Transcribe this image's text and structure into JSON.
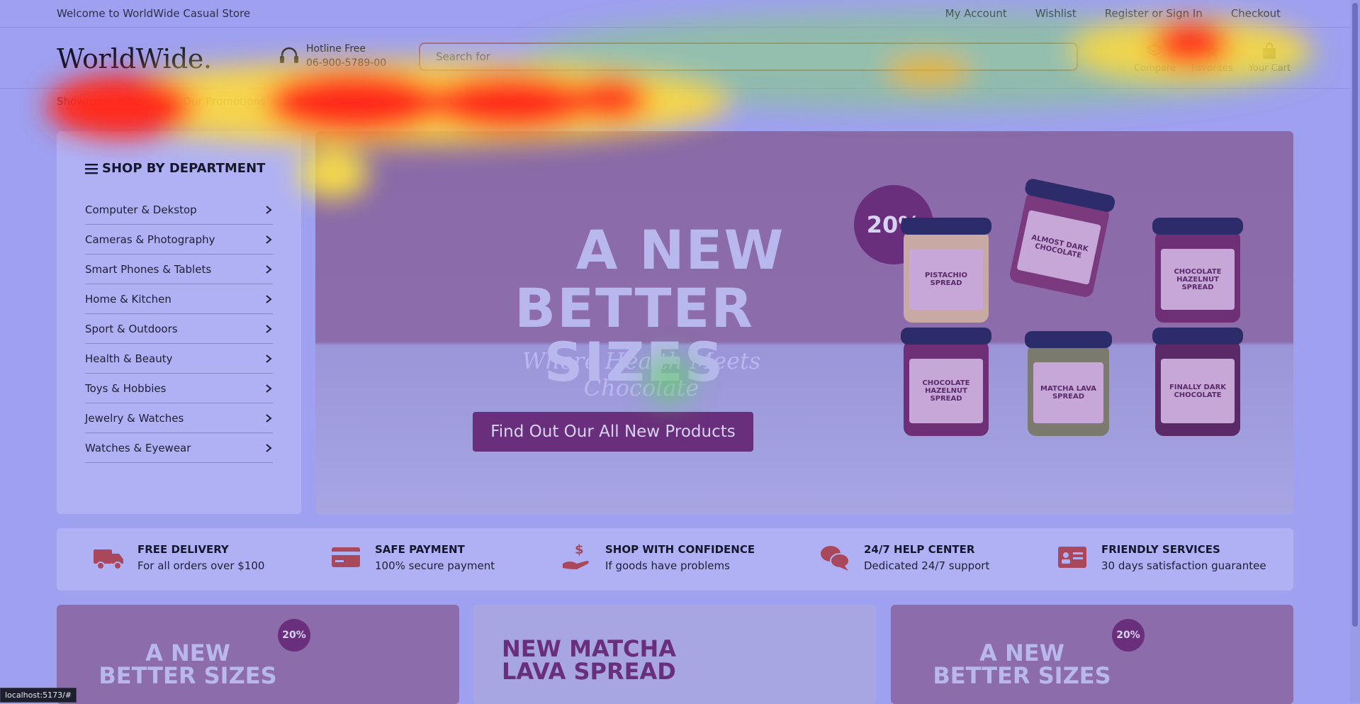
{
  "topbar": {
    "welcome": "Welcome to WorldWide Casual Store",
    "links": [
      "My Account",
      "Wishlist",
      "Register or Sign In",
      "Checkout"
    ]
  },
  "header": {
    "logo": "WorldWide.",
    "hotline_label": "Hotline Free",
    "hotline_number": "06-900-5789-00",
    "search_placeholder": "Search for",
    "icons": [
      {
        "label": "Compare",
        "icon": "compare-icon"
      },
      {
        "label": "Favorites",
        "icon": "star-icon"
      },
      {
        "label": "Your Cart",
        "icon": "cart-icon"
      }
    ]
  },
  "nav": [
    "Showroom system",
    "Our Promotions",
    "Track your order",
    "Services",
    "Support Customer"
  ],
  "sidebar": {
    "title": "SHOP BY DEPARTMENT",
    "categories": [
      "Computer & Dekstop",
      "Cameras & Photography",
      "Smart Phones & Tablets",
      "Home & Kitchen",
      "Sport & Outdoors",
      "Health & Beauty",
      "Toys & Hobbies",
      "Jewelry & Watches",
      "Watches & Eyewear"
    ]
  },
  "hero": {
    "title_line1": "A NEW",
    "title_line2": "BETTER SIZES",
    "subtitle": "Where Health Meets Chocolate",
    "cta": "Find Out Our All New Products",
    "badge": "20%",
    "jar_labels": [
      "PISTACHIO SPREAD",
      "ALMOST DARK CHOCOLATE",
      "CHOCOLATE HAZELNUT SPREAD",
      "CHOCOLATE HAZELNUT SPREAD",
      "MATCHA LAVA SPREAD",
      "FINALLY DARK CHOCOLATE"
    ]
  },
  "features": [
    {
      "title": "FREE DELIVERY",
      "subtitle": "For all orders over $100",
      "icon": "truck-icon"
    },
    {
      "title": "SAFE PAYMENT",
      "subtitle": "100% secure payment",
      "icon": "credit-card-icon"
    },
    {
      "title": "SHOP WITH CONFIDENCE",
      "subtitle": "If goods have problems",
      "icon": "money-hand-icon"
    },
    {
      "title": "24/7 HELP CENTER",
      "subtitle": "Dedicated 24/7 support",
      "icon": "chat-icon"
    },
    {
      "title": "FRIENDLY SERVICES",
      "subtitle": "30 days satisfaction guarantee",
      "icon": "id-card-icon"
    }
  ],
  "promos": [
    {
      "line1": "A NEW",
      "line2": "BETTER SIZES",
      "badge": "20%"
    },
    {
      "line1": "NEW MATCHA",
      "line2": "LAVA SPREAD"
    },
    {
      "line1": "A NEW",
      "line2": "BETTER SIZES",
      "badge": "20%"
    }
  ],
  "statusbar": "localhost:5173/#",
  "colors": {
    "accent": "#6a2f7c",
    "overlay": "#9fa0f0"
  }
}
